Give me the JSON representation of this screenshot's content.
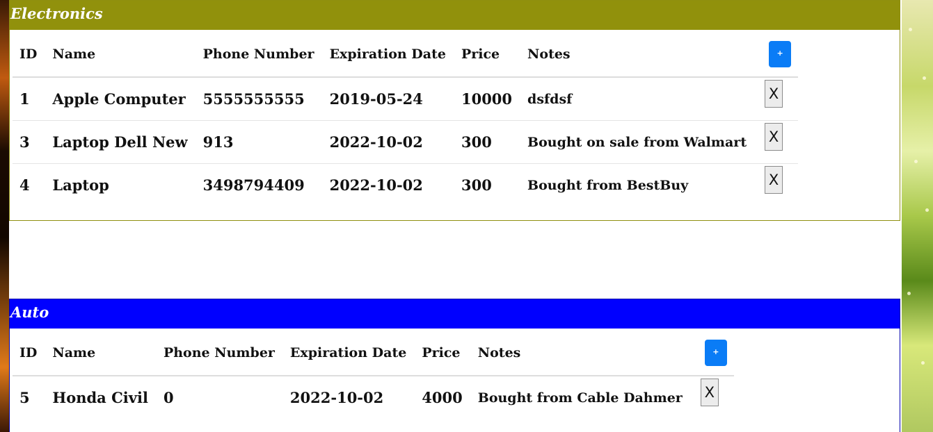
{
  "panels": [
    {
      "title": "Electronics",
      "headers": [
        "ID",
        "Name",
        "Phone Number",
        "Expiration Date",
        "Price",
        "Notes"
      ],
      "add_label": "+",
      "rows": [
        {
          "id": "1",
          "name": "Apple Computer",
          "phone": "5555555555",
          "expiration": "2019-05-24",
          "price": "10000",
          "notes": "dsfdsf",
          "delete_label": "X"
        },
        {
          "id": "3",
          "name": "Laptop Dell New",
          "phone": "913",
          "expiration": "2022-10-02",
          "price": "300",
          "notes": "Bought on sale from Walmart",
          "delete_label": "X"
        },
        {
          "id": "4",
          "name": "Laptop",
          "phone": "3498794409",
          "expiration": "2022-10-02",
          "price": "300",
          "notes": "Bought from BestBuy",
          "delete_label": "X"
        }
      ]
    },
    {
      "title": "Auto",
      "headers": [
        "ID",
        "Name",
        "Phone Number",
        "Expiration Date",
        "Price",
        "Notes"
      ],
      "add_label": "+",
      "rows": [
        {
          "id": "5",
          "name": "Honda Civil",
          "phone": "0",
          "expiration": "2022-10-02",
          "price": "4000",
          "notes": "Bought from Cable Dahmer",
          "delete_label": "X"
        }
      ]
    }
  ],
  "colors": {
    "electronics_header": "#91910c",
    "auto_header": "#0000ff",
    "add_button": "#0a7cf6"
  }
}
